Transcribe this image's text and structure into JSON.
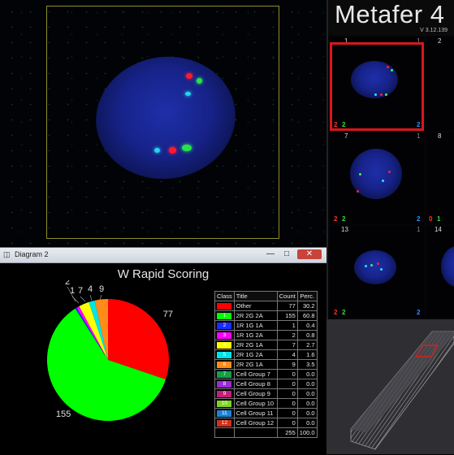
{
  "app": {
    "name": "Metafer 4",
    "version": "V 3.12.139"
  },
  "thumbnails": [
    {
      "number": "1",
      "corner": "1",
      "counts": [
        "2",
        "2",
        "2"
      ]
    },
    {
      "number": "2",
      "corner": "",
      "counts": []
    },
    {
      "number": "7",
      "corner": "1",
      "counts": [
        "2",
        "2",
        "2"
      ]
    },
    {
      "number": "8",
      "corner": "",
      "counts": [
        "0",
        "1"
      ]
    },
    {
      "number": "13",
      "corner": "1",
      "counts": [
        "2",
        "2",
        "2"
      ]
    },
    {
      "number": "14",
      "corner": "",
      "counts": []
    }
  ],
  "diagram": {
    "window_title": "Diagram 2",
    "minimize": "—",
    "maximize": "□",
    "close": "✕"
  },
  "chart_data": {
    "type": "pie",
    "title": "W Rapid Scoring",
    "slices": [
      {
        "label": "77",
        "value": 77,
        "color": "#ff0000"
      },
      {
        "label": "155",
        "value": 155,
        "color": "#00ff00"
      },
      {
        "label": "1",
        "value": 1,
        "color": "#1a2cff"
      },
      {
        "label": "2",
        "value": 2,
        "color": "#ff00ff"
      },
      {
        "label": "7",
        "value": 7,
        "color": "#ffff00"
      },
      {
        "label": "4",
        "value": 4,
        "color": "#00e5e5"
      },
      {
        "label": "9",
        "value": 9,
        "color": "#ff8c1a"
      }
    ],
    "table": {
      "headers": [
        "Class",
        "Title",
        "Count",
        "Perc."
      ],
      "rows": [
        {
          "cls": "",
          "title": "Other",
          "count": "77",
          "perc": "30.2",
          "color": "#ff0000"
        },
        {
          "cls": "1",
          "title": "2R 2G 2A",
          "count": "155",
          "perc": "60.8",
          "color": "#00ff00"
        },
        {
          "cls": "2",
          "title": "1R 1G 1A",
          "count": "1",
          "perc": "0.4",
          "color": "#1a2cff"
        },
        {
          "cls": "3",
          "title": "1R 1G 2A",
          "count": "2",
          "perc": "0.8",
          "color": "#ff00ff"
        },
        {
          "cls": "4",
          "title": "2R 2G 1A",
          "count": "7",
          "perc": "2.7",
          "color": "#ffff00"
        },
        {
          "cls": "5",
          "title": "2R 1G 2A",
          "count": "4",
          "perc": "1.6",
          "color": "#00e5e5"
        },
        {
          "cls": "6",
          "title": "2R 2G 1A",
          "count": "9",
          "perc": "3.5",
          "color": "#ff8c1a"
        },
        {
          "cls": "7",
          "title": "Cell Group 7",
          "count": "0",
          "perc": "0.0",
          "color": "#14a04a"
        },
        {
          "cls": "8",
          "title": "Cell Group 8",
          "count": "0",
          "perc": "0.0",
          "color": "#9b2bd6"
        },
        {
          "cls": "9",
          "title": "Cell Group 9",
          "count": "0",
          "perc": "0.0",
          "color": "#c41e7a"
        },
        {
          "cls": "10",
          "title": "Cell Group 10",
          "count": "0",
          "perc": "0.0",
          "color": "#7ed321"
        },
        {
          "cls": "11",
          "title": "Cell Group 11",
          "count": "0",
          "perc": "0.0",
          "color": "#1b83d6"
        },
        {
          "cls": "12",
          "title": "Cell Group 12",
          "count": "0",
          "perc": "0.0",
          "color": "#d0301e"
        }
      ],
      "total": {
        "count": "255",
        "perc": "100.0"
      }
    }
  }
}
